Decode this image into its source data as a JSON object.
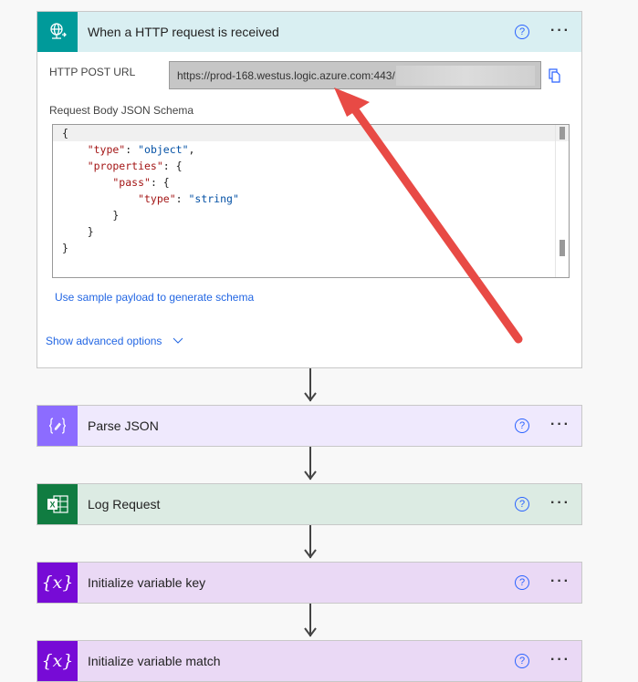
{
  "trigger": {
    "title": "When a HTTP request is received",
    "icon": "globe-network-icon",
    "color": "#009a9a",
    "post_url_label": "HTTP POST URL",
    "post_url_value": "https://prod-168.westus.logic.azure.com:443/",
    "schema_label": "Request Body JSON Schema",
    "schema_lines": [
      "{",
      "    \"type\": \"object\",",
      "    \"properties\": {",
      "        \"pass\": {",
      "            \"type\": \"string\"",
      "        }",
      "    }",
      "}"
    ],
    "sample_link": "Use sample payload to generate schema",
    "advanced_link": "Show advanced options",
    "help": "?",
    "more": "···"
  },
  "steps": [
    {
      "title": "Parse JSON",
      "icon": "braces-pencil-icon",
      "color": "#8c6cff",
      "help": "?",
      "more": "···"
    },
    {
      "title": "Log Request",
      "icon": "excel-icon",
      "color": "#107c41",
      "help": "?",
      "more": "···"
    },
    {
      "title": "Initialize variable key",
      "icon": "variable-icon",
      "color": "#770bd6",
      "help": "?",
      "more": "···"
    },
    {
      "title": "Initialize variable match",
      "icon": "variable-icon",
      "color": "#770bd6",
      "help": "?",
      "more": "···"
    }
  ]
}
